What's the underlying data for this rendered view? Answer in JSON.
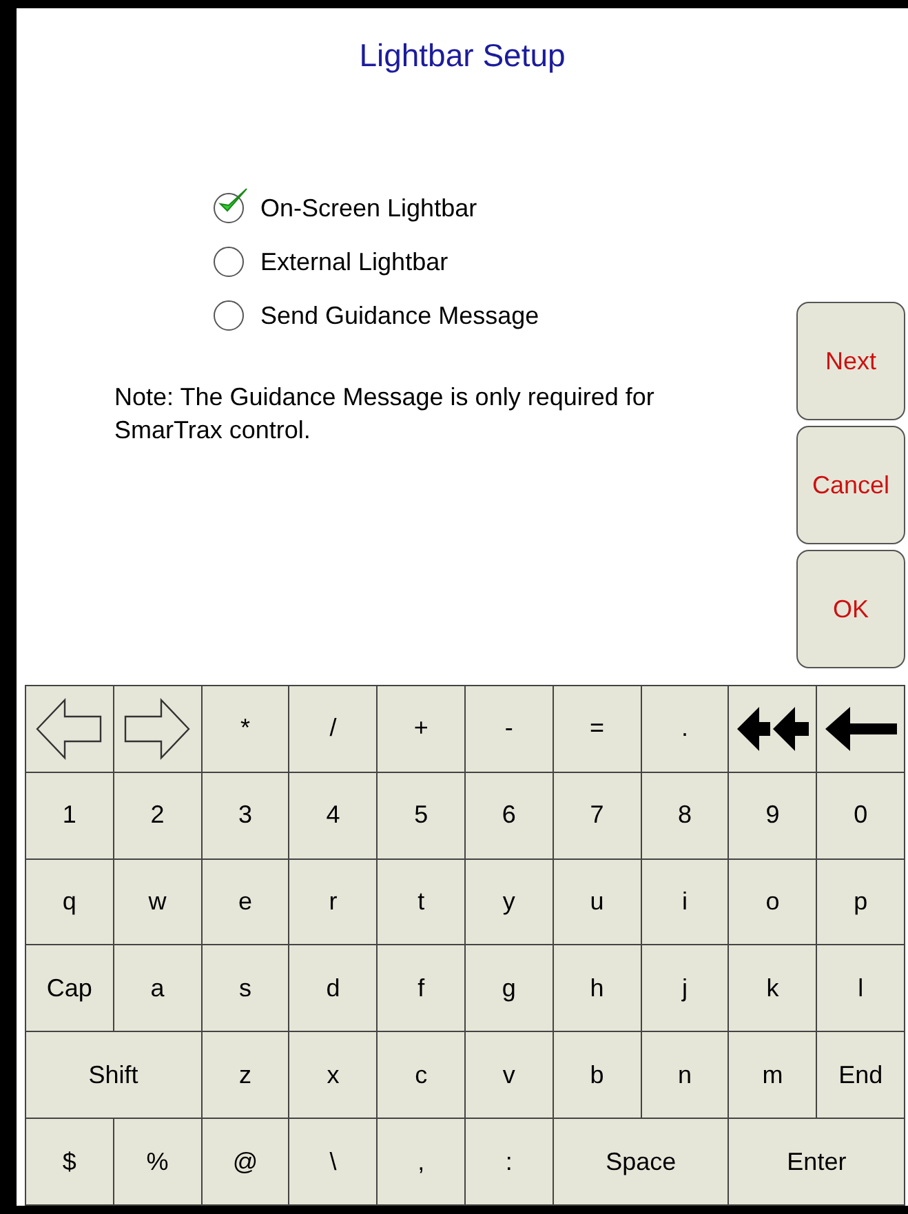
{
  "title": "Lightbar Setup",
  "options": [
    {
      "label": "On-Screen Lightbar",
      "selected": true
    },
    {
      "label": "External Lightbar",
      "selected": false
    },
    {
      "label": "Send Guidance Message",
      "selected": false
    }
  ],
  "note": "Note: The Guidance Message is only required for SmarTrax control.",
  "buttons": [
    "Next",
    "Cancel",
    "OK"
  ],
  "keyboard": [
    [
      {
        "kind": "arrow-left"
      },
      {
        "kind": "arrow-right"
      },
      {
        "kind": "key",
        "label": "*"
      },
      {
        "kind": "key",
        "label": "/"
      },
      {
        "kind": "key",
        "label": "+"
      },
      {
        "kind": "key",
        "label": "-"
      },
      {
        "kind": "key",
        "label": "="
      },
      {
        "kind": "key",
        "label": "."
      },
      {
        "kind": "clear"
      },
      {
        "kind": "backspace"
      }
    ],
    [
      {
        "kind": "key",
        "label": "1"
      },
      {
        "kind": "key",
        "label": "2"
      },
      {
        "kind": "key",
        "label": "3"
      },
      {
        "kind": "key",
        "label": "4"
      },
      {
        "kind": "key",
        "label": "5"
      },
      {
        "kind": "key",
        "label": "6"
      },
      {
        "kind": "key",
        "label": "7"
      },
      {
        "kind": "key",
        "label": "8"
      },
      {
        "kind": "key",
        "label": "9"
      },
      {
        "kind": "key",
        "label": "0"
      }
    ],
    [
      {
        "kind": "key",
        "label": "q"
      },
      {
        "kind": "key",
        "label": "w"
      },
      {
        "kind": "key",
        "label": "e"
      },
      {
        "kind": "key",
        "label": "r"
      },
      {
        "kind": "key",
        "label": "t"
      },
      {
        "kind": "key",
        "label": "y"
      },
      {
        "kind": "key",
        "label": "u"
      },
      {
        "kind": "key",
        "label": "i"
      },
      {
        "kind": "key",
        "label": "o"
      },
      {
        "kind": "key",
        "label": "p"
      }
    ],
    [
      {
        "kind": "key",
        "label": "Cap"
      },
      {
        "kind": "key",
        "label": "a"
      },
      {
        "kind": "key",
        "label": "s"
      },
      {
        "kind": "key",
        "label": "d"
      },
      {
        "kind": "key",
        "label": "f"
      },
      {
        "kind": "key",
        "label": "g"
      },
      {
        "kind": "key",
        "label": "h"
      },
      {
        "kind": "key",
        "label": "j"
      },
      {
        "kind": "key",
        "label": "k"
      },
      {
        "kind": "key",
        "label": "l"
      }
    ],
    [
      {
        "kind": "wide",
        "label": "Shift"
      },
      {
        "kind": "key",
        "label": "z"
      },
      {
        "kind": "key",
        "label": "x"
      },
      {
        "kind": "key",
        "label": "c"
      },
      {
        "kind": "key",
        "label": "v"
      },
      {
        "kind": "key",
        "label": "b"
      },
      {
        "kind": "key",
        "label": "n"
      },
      {
        "kind": "key",
        "label": "m"
      },
      {
        "kind": "key",
        "label": "End"
      }
    ],
    [
      {
        "kind": "key",
        "label": "$"
      },
      {
        "kind": "key",
        "label": "%"
      },
      {
        "kind": "key",
        "label": "@"
      },
      {
        "kind": "key",
        "label": "\\"
      },
      {
        "kind": "key",
        "label": ","
      },
      {
        "kind": "key",
        "label": ":"
      },
      {
        "kind": "wide",
        "label": "Space"
      },
      {
        "kind": "wide",
        "label": "Enter"
      }
    ]
  ]
}
